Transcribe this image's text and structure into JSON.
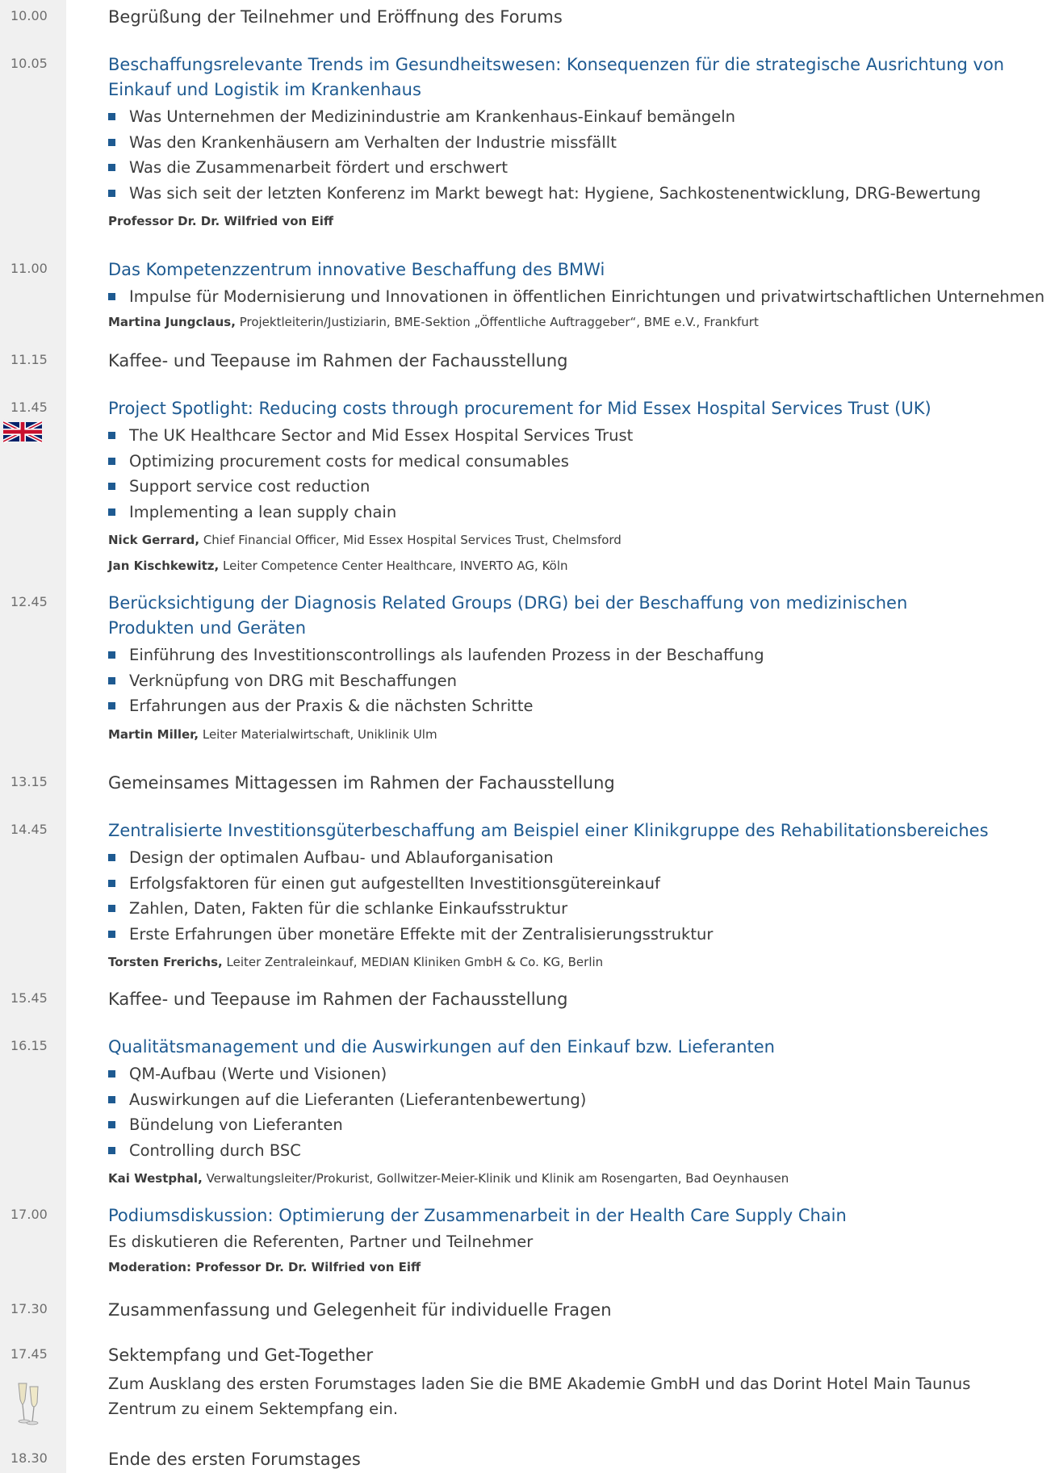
{
  "agenda": [
    {
      "time": "10.00",
      "title": "Begrüßung der Teilnehmer und Eröffnung des Forums",
      "title_style": "plain",
      "bullets": [],
      "speakers": []
    },
    {
      "time": "10.05",
      "title": "Beschaffungsrelevante Trends im Gesundheitswesen: Konsequenzen für die strategische Ausrichtung von Einkauf und Logistik im Krankenhaus",
      "title_style": "link",
      "bullets": [
        "Was Unternehmen der Medizinindustrie am Krankenhaus-Einkauf bemängeln",
        "Was den Krankenhäusern am Verhalten der Industrie missfällt",
        "Was die Zusammenarbeit fördert und erschwert",
        "Was sich seit der letzten Konferenz im Markt bewegt hat: Hygiene, Sachkostenentwicklung, DRG-Bewertung"
      ],
      "speakers": [
        {
          "name": "Professor Dr. Dr. Wilfried von Eiff",
          "role": ""
        }
      ]
    },
    {
      "time": "11.00",
      "title": "Das Kompetenzzentrum innovative Beschaffung des BMWi",
      "title_style": "link",
      "bullets": [
        "Impulse für Modernisierung und Innovationen in öffentlichen Einrichtungen und privatwirtschaftlichen Unternehmen"
      ],
      "speakers": [
        {
          "name": "Martina Jungclaus,",
          "role": "Projektleiterin/Justiziarin, BME-Sektion „Öffentliche Auftraggeber“, BME e.V., Frankfurt"
        }
      ]
    },
    {
      "time": "11.15",
      "title": "Kaffee- und Teepause im Rahmen der Fachausstellung",
      "title_style": "plain",
      "bullets": [],
      "speakers": []
    },
    {
      "time": "11.45",
      "title": "Project Spotlight: Reducing costs through procurement for Mid Essex Hospital Services Trust (UK)",
      "title_style": "link",
      "icon": "uk-flag-icon",
      "bullets": [
        "The UK Healthcare Sector and Mid Essex Hospital Services Trust",
        "Optimizing procurement costs for medical consumables",
        "Support service cost reduction",
        "Implementing a lean supply chain"
      ],
      "speakers": [
        {
          "name": "Nick Gerrard,",
          "role": "Chief Financial Officer, Mid Essex Hospital Services Trust, Chelmsford"
        },
        {
          "name": "Jan Kischkewitz,",
          "role": "Leiter Competence Center Healthcare, INVERTO AG, Köln"
        }
      ]
    },
    {
      "time": "12.45",
      "title": "Berücksichtigung der Diagnosis Related Groups (DRG) bei der Beschaffung von medizinischen Produkten und Geräten",
      "title_style": "link",
      "bullets": [
        "Einführung des Investitionscontrollings als laufenden Prozess in der Beschaffung",
        "Verknüpfung von DRG mit Beschaffungen",
        "Erfahrungen aus der Praxis & die nächsten Schritte"
      ],
      "speakers": [
        {
          "name": "Martin Miller,",
          "role": "Leiter Materialwirtschaft, Uniklinik Ulm"
        }
      ]
    },
    {
      "time": "13.15",
      "title": "Gemeinsames Mittagessen im Rahmen der Fachausstellung",
      "title_style": "plain",
      "bullets": [],
      "speakers": []
    },
    {
      "time": "14.45",
      "title": "Zentralisierte Investitionsgüterbeschaffung am Beispiel einer Klinikgruppe des Rehabilitationsbereiches",
      "title_style": "link",
      "bullets": [
        "Design der optimalen Aufbau- und Ablauforganisation",
        "Erfolgsfaktoren für einen gut aufgestellten Investitionsgütereinkauf",
        "Zahlen, Daten, Fakten für die schlanke Einkaufsstruktur",
        "Erste Erfahrungen über monetäre Effekte mit der Zentralisierungsstruktur"
      ],
      "speakers": [
        {
          "name": "Torsten Frerichs,",
          "role": "Leiter Zentraleinkauf, MEDIAN Kliniken GmbH & Co. KG, Berlin"
        }
      ]
    },
    {
      "time": "15.45",
      "title": "Kaffee- und Teepause im Rahmen der Fachausstellung",
      "title_style": "plain",
      "bullets": [],
      "speakers": []
    },
    {
      "time": "16.15",
      "title": "Qualitätsmanagement und die Auswirkungen auf den Einkauf bzw. Lieferanten",
      "title_style": "link",
      "bullets": [
        "QM-Aufbau (Werte und Visionen)",
        "Auswirkungen auf die Lieferanten (Lieferantenbewertung)",
        "Bündelung von Lieferanten",
        "Controlling durch BSC"
      ],
      "speakers": [
        {
          "name": "Kai Westphal,",
          "role": "Verwaltungsleiter/Prokurist, Gollwitzer-Meier-Klinik und Klinik am Rosengarten, Bad Oeynhausen"
        }
      ]
    },
    {
      "time": "17.00",
      "title": "Podiumsdiskussion: Optimierung der Zusammenarbeit in der Health Care Supply Chain",
      "title_style": "link",
      "note": "Es diskutieren die Referenten, Partner und Teilnehmer",
      "bullets": [],
      "speakers": [
        {
          "name": "Moderation: Professor Dr. Dr. Wilfried von Eiff",
          "role": ""
        }
      ]
    },
    {
      "time": "17.30",
      "title": "Zusammenfassung und Gelegenheit für individuelle Fragen",
      "title_style": "plain",
      "bullets": [],
      "speakers": []
    },
    {
      "time": "17.45",
      "title": "Sektempfang und Get-Together",
      "title_style": "plain",
      "icon": "champagne-glasses-icon",
      "note": "Zum Ausklang des ersten Forumstages laden Sie die BME Akademie GmbH und das Dorint Hotel Main Taunus Zentrum zu einem Sektempfang ein.",
      "bullets": [],
      "speakers": []
    },
    {
      "time": "18.30",
      "title": "Ende des ersten Forumstages",
      "title_style": "plain",
      "bullets": [],
      "speakers": []
    }
  ],
  "colors": {
    "accent": "#1e5a91",
    "text": "#3c3c3c",
    "time_column": "#f0f0f0"
  }
}
